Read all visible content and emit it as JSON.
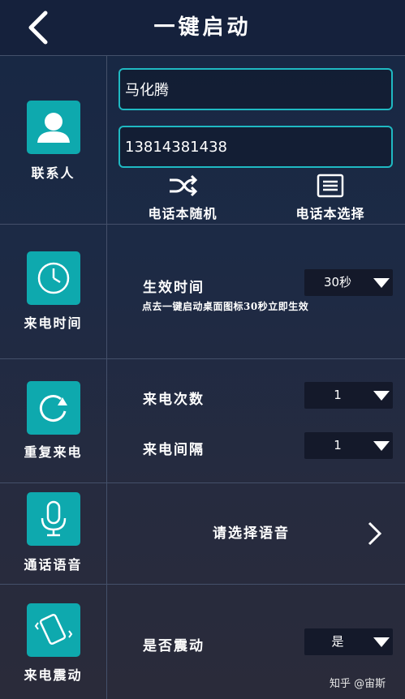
{
  "header": {
    "title": "一键启动",
    "back_icon": "chevron-left-icon"
  },
  "contact": {
    "label": "联系人",
    "icon": "person-icon",
    "name_value": "马化腾",
    "phone_value": "13814381438",
    "random_label": "电话本随机",
    "random_icon": "shuffle-icon",
    "select_label": "电话本选择",
    "select_icon": "list-icon"
  },
  "call_time": {
    "label": "来电时间",
    "icon": "clock-icon",
    "field_label": "生效时间",
    "selected": "30秒",
    "hint": "点去一键启动桌面图标30秒立即生效"
  },
  "repeat": {
    "label": "重复来电",
    "icon": "repeat-icon",
    "count_label": "来电次数",
    "count_selected": "1",
    "interval_label": "来电间隔",
    "interval_selected": "1"
  },
  "voice": {
    "label": "通话语音",
    "icon": "microphone-icon",
    "action_label": "请选择语音",
    "chevron_icon": "chevron-right-icon"
  },
  "vibrate": {
    "label": "来电震动",
    "icon": "vibrate-phone-icon",
    "field_label": "是否震动",
    "selected": "是"
  },
  "watermark": "知乎 @宙斯",
  "colors": {
    "accent": "#0ea9ae",
    "field_border": "#1fb9c2",
    "header_bg": "#15213c",
    "dropdown_bg": "#14192a"
  }
}
